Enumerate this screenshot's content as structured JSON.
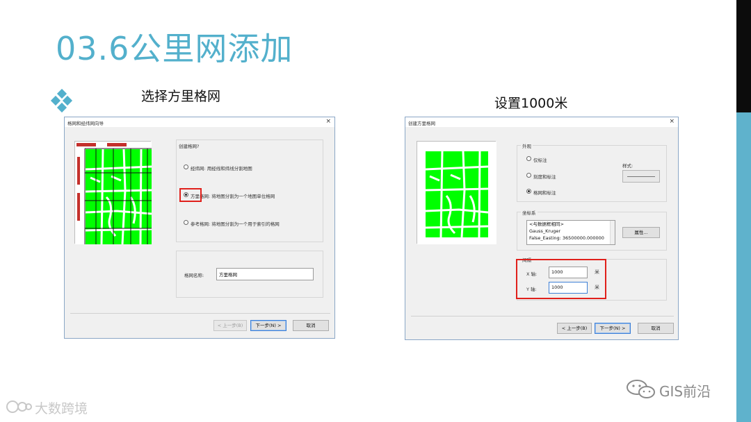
{
  "slide": {
    "title": "03.6公里网添加",
    "caption_left": "选择方里格网",
    "caption_right": "设置1000米"
  },
  "colors": {
    "title": "#53b0cc",
    "band_top": "#0c0c0c",
    "band_bottom": "#5fb2cc",
    "map_fill": "#00ff00",
    "highlight": "#e0201b"
  },
  "dialog_left": {
    "title": "格网和经纬网向导",
    "close": "×",
    "group_label": "创建格网?",
    "options": [
      {
        "label": "经纬网: 用经线和纬线分割地图",
        "selected": false
      },
      {
        "label": "方里格网: 将地图分割为一个地图单位格网",
        "selected": true
      },
      {
        "label": "参考格网: 将地图分割为一个用于索引的格网",
        "selected": false
      }
    ],
    "name_label": "格网名称:",
    "name_value": "方里格网",
    "buttons": {
      "back": "< 上一步(B)",
      "next": "下一步(N) >",
      "cancel": "取消"
    }
  },
  "dialog_right": {
    "title": "创建方里格网",
    "close": "×",
    "appearance_label": "外观",
    "options": [
      {
        "label": "仅标注",
        "selected": false
      },
      {
        "label": "刻度和标注",
        "selected": false
      },
      {
        "label": "格网和标注",
        "selected": true
      }
    ],
    "style_label": "样式:",
    "coord_label": "坐标系",
    "coord_lines": [
      "<与数据框相同>",
      "Gauss_Kruger",
      "False_Easting: 36500000.000000"
    ],
    "properties_button": "属性...",
    "interval_label": "间隔",
    "x_label": "X 轴:",
    "x_value": "1000",
    "x_unit": "米",
    "y_label": "Y 轴:",
    "y_value": "1000",
    "y_unit": "米",
    "buttons": {
      "back": "< 上一步(B)",
      "next": "下一步(N) >",
      "cancel": "取消"
    }
  },
  "watermarks": {
    "left": "大数跨境",
    "right": "GIS前沿"
  }
}
